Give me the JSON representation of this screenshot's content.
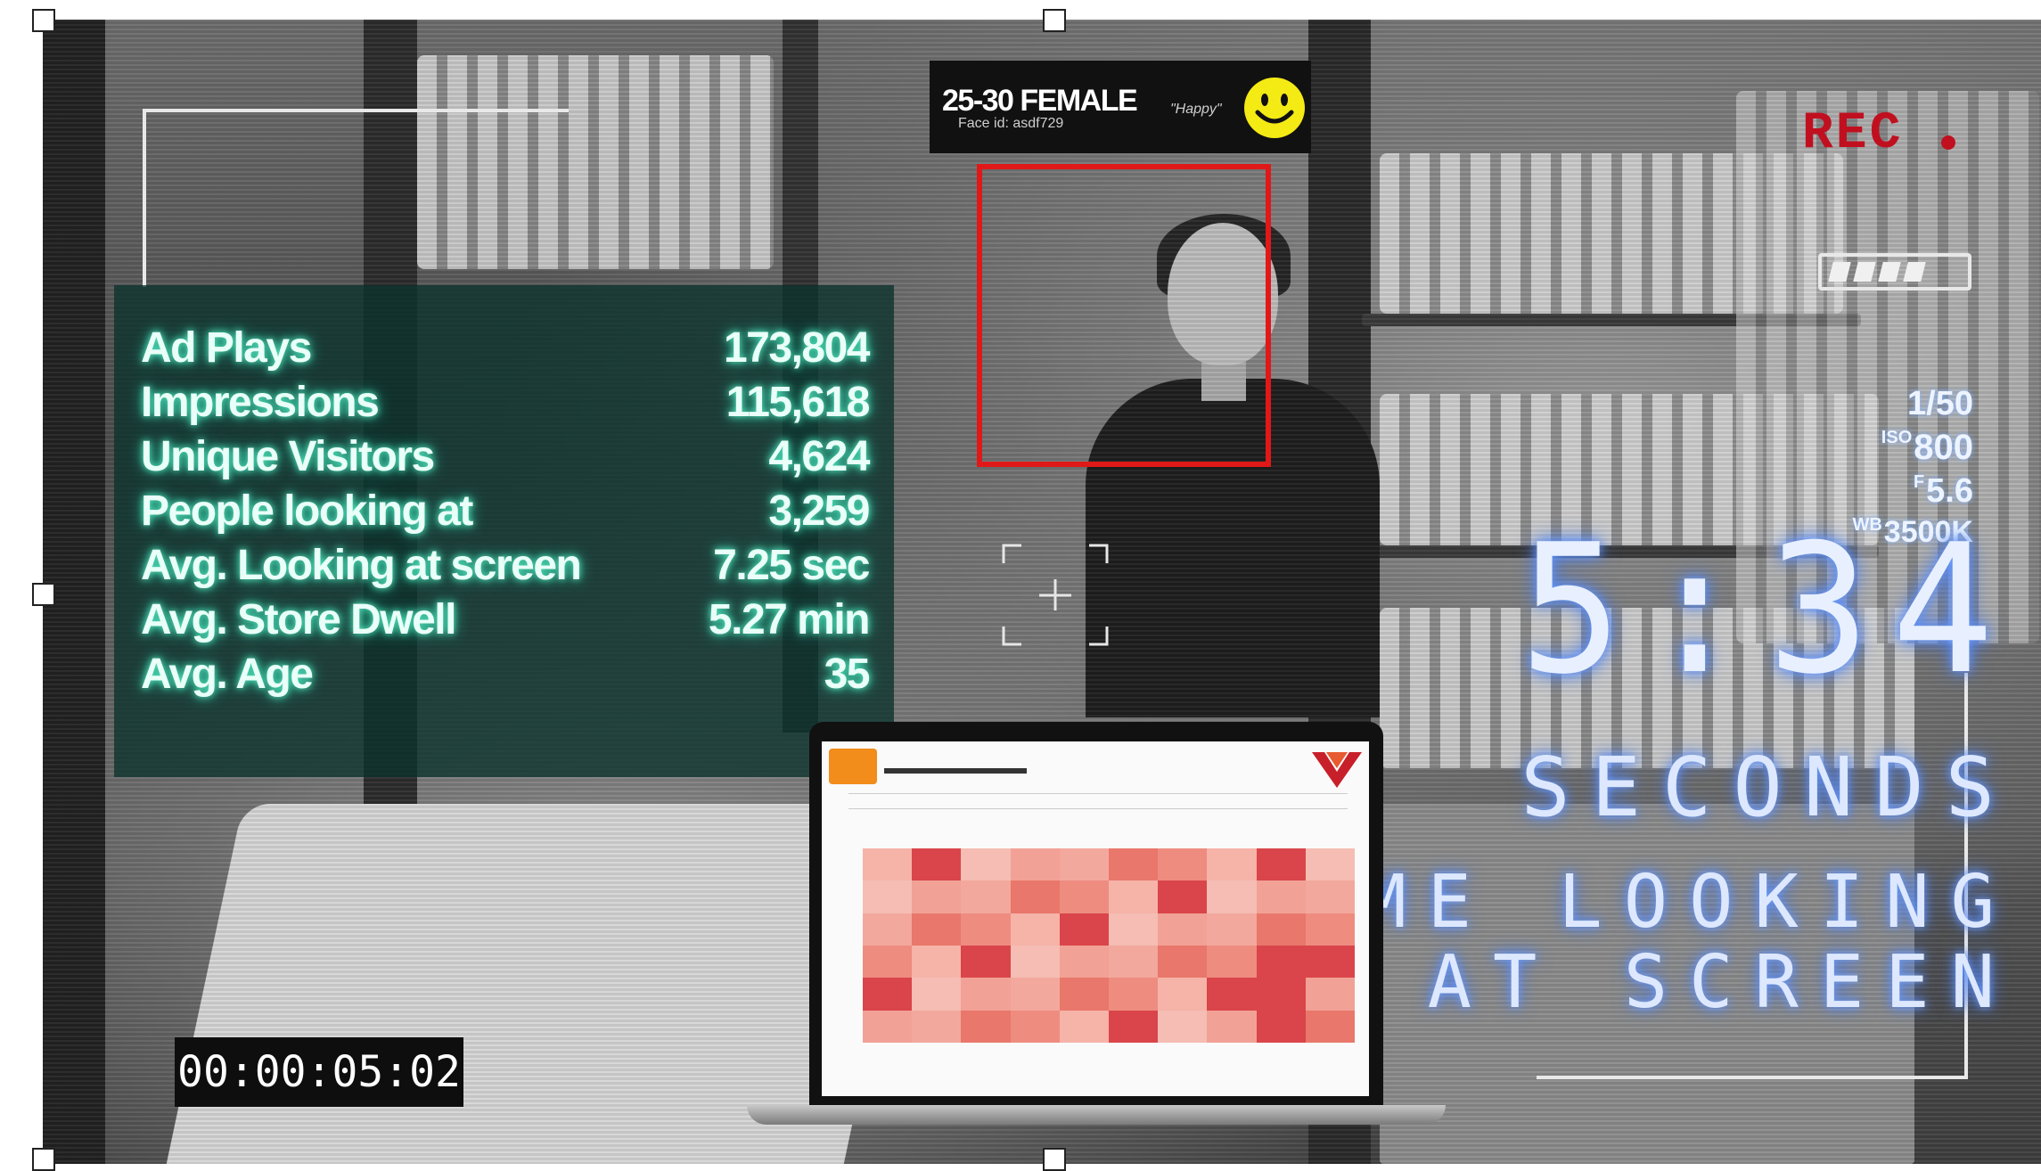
{
  "detection_tag": {
    "title": "25-30 FEMALE",
    "subtitle": "Face id: asdf729",
    "mood": "\"Happy\""
  },
  "metrics": [
    {
      "label": "Ad Plays",
      "value": "173,804"
    },
    {
      "label": "Impressions",
      "value": "115,618"
    },
    {
      "label": "Unique Visitors",
      "value": "4,624"
    },
    {
      "label": "People looking at",
      "value": "3,259"
    },
    {
      "label": "Avg. Looking at screen",
      "value": "7.25 sec"
    },
    {
      "label": "Avg. Store Dwell",
      "value": "5.27 min"
    },
    {
      "label": "Avg. Age",
      "value": "35"
    }
  ],
  "camera": {
    "rec_label": "REC",
    "shutter": "1/50",
    "iso_prefix": "ISO",
    "iso": "800",
    "aperture_prefix": "F",
    "aperture": "5.6",
    "wb_prefix": "WB",
    "white_balance": "3500K",
    "battery_level": 0.8
  },
  "timer": {
    "value": "5:34",
    "unit": "SECONDS",
    "caption_line1": "TIME LOOKING",
    "caption_line2": "AT SCREEN"
  },
  "timecode": "00:00:05:02",
  "colors": {
    "face_box": "#e01818",
    "rec": "#c01020",
    "metrics_glow": "#5af2c8",
    "hud_glow": "#6a9cff",
    "dashboard_accent": "#f28c1b"
  },
  "icons": [
    "smiley-icon",
    "focus-reticle-icon",
    "battery-icon",
    "rec-dot-icon",
    "brand-logo-icon"
  ]
}
